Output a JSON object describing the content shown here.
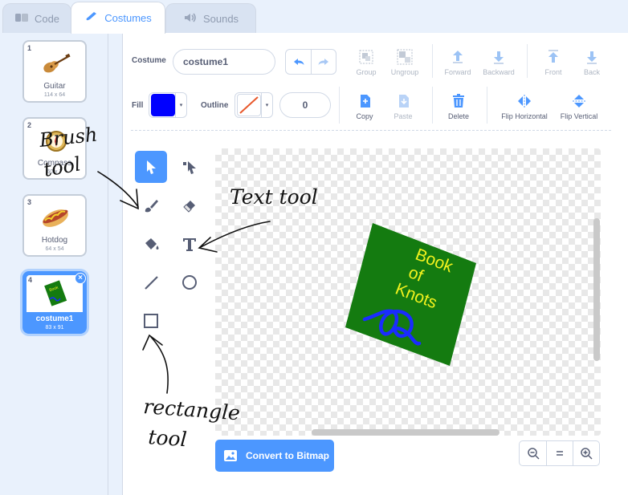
{
  "tabs": [
    {
      "label": "Code",
      "icon": "code-icon"
    },
    {
      "label": "Costumes",
      "icon": "brush-icon"
    },
    {
      "label": "Sounds",
      "icon": "speaker-icon"
    }
  ],
  "costumes": [
    {
      "number": "1",
      "name": "Guitar",
      "size": "114 x 64"
    },
    {
      "number": "2",
      "name": "Compass",
      "size": "60 x 7"
    },
    {
      "number": "3",
      "name": "Hotdog",
      "size": "64 x 54"
    },
    {
      "number": "4",
      "name": "costume1",
      "size": "83 x 91",
      "selected": true
    }
  ],
  "toolbar": {
    "costume_label": "Costume",
    "costume_name": "costume1",
    "fill_label": "Fill",
    "fill_color": "#0000ff",
    "outline_label": "Outline",
    "outline_width": "0",
    "group": "Group",
    "ungroup": "Ungroup",
    "forward": "Forward",
    "backward": "Backward",
    "front": "Front",
    "back": "Back",
    "copy": "Copy",
    "paste": "Paste",
    "delete": "Delete",
    "flip_horizontal": "Flip Horizontal",
    "flip_vertical": "Flip Vertical"
  },
  "tools": [
    "select",
    "reshape",
    "brush",
    "eraser",
    "fill",
    "text",
    "line",
    "circle",
    "rectangle"
  ],
  "canvas": {
    "book_title_lines": [
      "Book",
      "of",
      "Knots"
    ],
    "book_color": "#147b10",
    "text_color": "#f2f21e"
  },
  "convert_button": "Convert to Bitmap",
  "annotations": {
    "brush": [
      "Brush",
      "tool"
    ],
    "text": "Text tool",
    "rectangle": [
      "rectangle",
      "tool"
    ]
  },
  "colors": {
    "accent": "#4c97ff",
    "text": "#575e75"
  }
}
